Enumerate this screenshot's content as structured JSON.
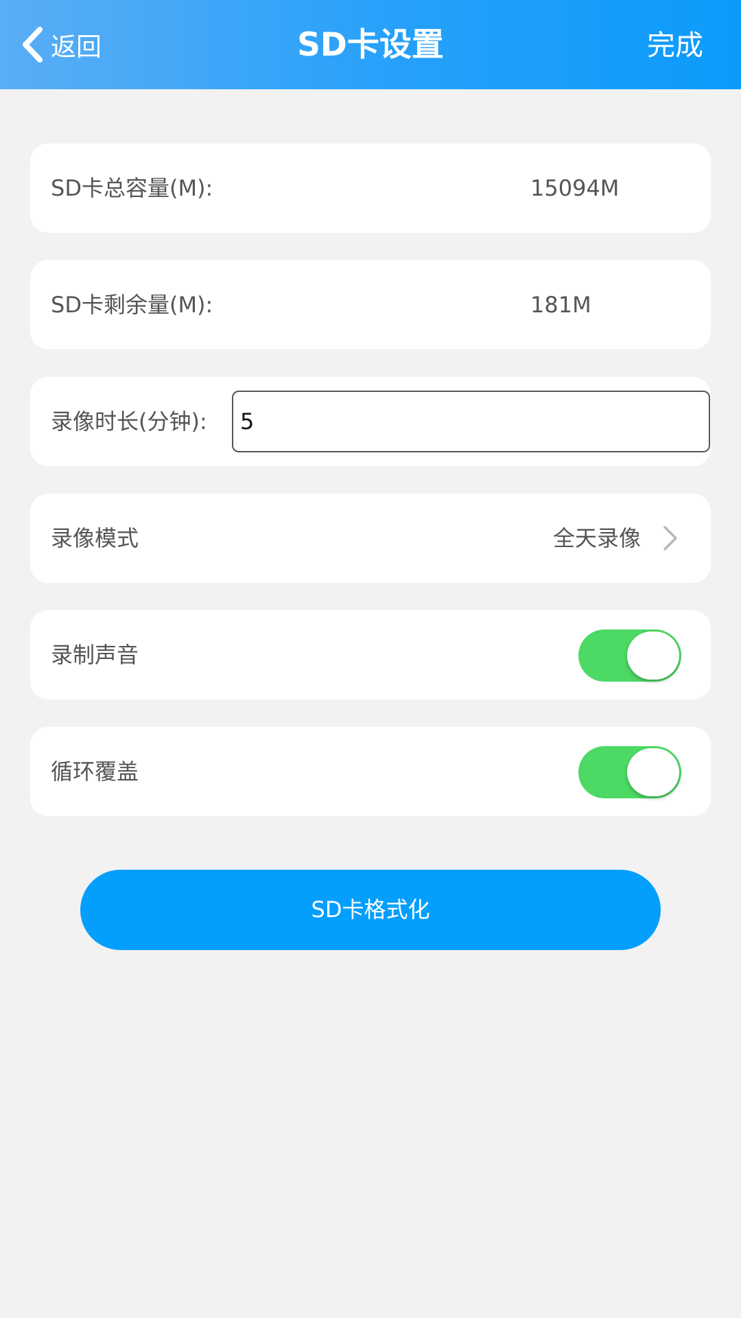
{
  "header": {
    "back_label": "返回",
    "title": "SD卡设置",
    "done_label": "完成"
  },
  "settings": {
    "total_capacity": {
      "label": "SD卡总容量(M):",
      "value": "15094M"
    },
    "remaining_capacity": {
      "label": "SD卡剩余量(M):",
      "value": "181M"
    },
    "record_duration": {
      "label": "录像时长(分钟):",
      "value": "5"
    },
    "record_mode": {
      "label": "录像模式",
      "value": "全天录像"
    },
    "record_audio": {
      "label": "录制声音",
      "enabled": true
    },
    "loop_overwrite": {
      "label": "循环覆盖",
      "enabled": true
    }
  },
  "format_button": {
    "label": "SD卡格式化"
  },
  "colors": {
    "header_start": "#5aaef5",
    "header_end": "#0c9bfb",
    "background": "#f2f2f2",
    "toggle_on": "#4cd964",
    "button_primary": "#049ffd"
  }
}
